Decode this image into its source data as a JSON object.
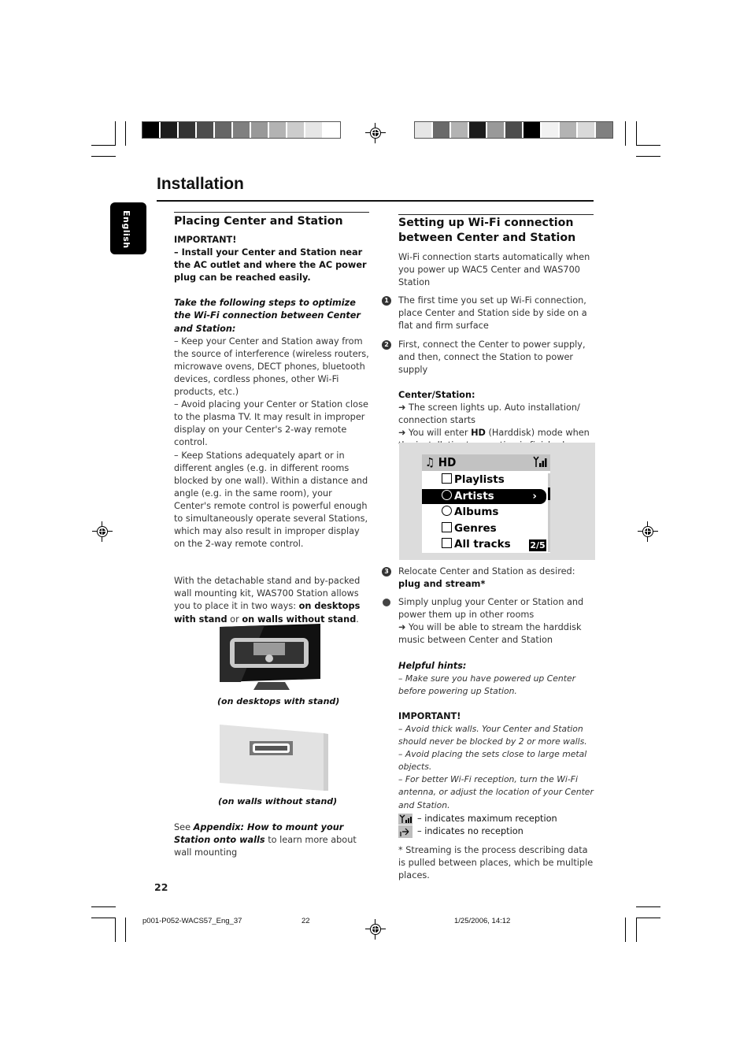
{
  "page": {
    "title": "Installation",
    "language_tab": "English",
    "page_number": "22"
  },
  "color_bars": {
    "left": [
      "#000000",
      "#1c1c1c",
      "#333333",
      "#4d4d4d",
      "#666666",
      "#808080",
      "#999999",
      "#b3b3b3",
      "#cccccc",
      "#e6e6e6",
      "#ffffff"
    ],
    "right": [
      "#e6e6e6",
      "#6a6a6a",
      "#b3b3b3",
      "#1c1c1c",
      "#999999",
      "#4d4d4d",
      "#000000",
      "#f2f2f2",
      "#b3b3b3",
      "#d9d9d9",
      "#808080"
    ]
  },
  "left_column": {
    "heading": "Placing Center and Station",
    "important_label": "IMPORTANT!",
    "important_text": "–  Install your Center and Station near the AC outlet and where the AC power plug can be reached easily.",
    "steps_intro": "Take the following steps to optimize the Wi-Fi connection between Center and Station:",
    "bullets": [
      "–   Keep your Center and Station away from the source of interference (wireless routers, microwave ovens, DECT phones, bluetooth devices, cordless phones,  other Wi-Fi products, etc.)",
      "–   Avoid placing your Center or Station close to the plasma TV.  It may result in improper display on your Center's 2-way remote control.",
      "–   Keep Stations adequately apart or in different angles (e.g. in different rooms blocked by one wall).  Within a distance and angle (e.g. in the same room), your Center's remote control is powerful enough to simultaneously operate several Stations, which may also result in improper display on the 2-way remote control."
    ],
    "stand_text_1": "With the detachable stand and by-packed wall mounting kit, WAS700 Station allows you to place it in two ways: ",
    "stand_bold_1": "on desktops with stand",
    "stand_text_2": " or ",
    "stand_bold_2": "on walls without stand",
    "stand_text_3": ".",
    "caption_desktop": "(on desktops with stand)",
    "caption_wall": "(on walls without stand)",
    "see_prefix": "See ",
    "see_bold": "Appendix: How to mount your Station onto walls",
    "see_suffix": " to learn more about wall mounting"
  },
  "right_column": {
    "heading": "Setting up  Wi-Fi connection between Center and Station",
    "intro": "Wi-Fi connection starts automatically when you power up WAC5 Center and WAS700 Station",
    "step1_num": "1",
    "step1": "The first time you set up Wi-Fi connection, place Center and Station side by side on a flat and firm surface",
    "step2_num": "2",
    "step2": "First, connect the Center to power supply, and then, connect the Station to power supply",
    "center_station_label": "Center/Station:",
    "result1": "➜ The screen lights up.  Auto installation/ connection starts",
    "result2_prefix": "➜ You will enter ",
    "result2_bold": "HD",
    "result2_suffix": " (Harddisk) mode when the installation/connection is finished",
    "screen": {
      "header": "♫ HD",
      "items": [
        "Playlists",
        "Artists",
        "Albums",
        "Genres",
        "All tracks"
      ],
      "selected_index": 1,
      "selected_arrow": "›",
      "page_indicator": "2/5"
    },
    "step3_num": "3",
    "step3_text": "Relocate Center and Station as desired: ",
    "step3_bold": "plug and stream*",
    "bullet_text": "Simply unplug your Center or Station and power them up in other rooms",
    "bullet_result": "➜ You will be able to stream the harddisk music between Center and Station",
    "hints_label": "Helpful hints:",
    "hints_text": "–  Make sure you have powered up Center before powering up Station.",
    "important_label": "IMPORTANT!",
    "important_items": [
      "–  Avoid thick walls.  Your Center and Station should never be blocked by 2 or more walls.",
      "–  Avoid placing the sets close to large metal objects.",
      "–  For better Wi-Fi reception, turn the Wi-Fi antenna, or adjust the location of your Center and Station."
    ],
    "legend_max": "– indicates maximum reception",
    "legend_none": "– indicates no reception",
    "footnote": "* Streaming is the process describing data is pulled between places, which be multiple places."
  },
  "footer": {
    "file": "p001-P052-WACS57_Eng_37",
    "page": "22",
    "datetime": "1/25/2006, 14:12"
  }
}
